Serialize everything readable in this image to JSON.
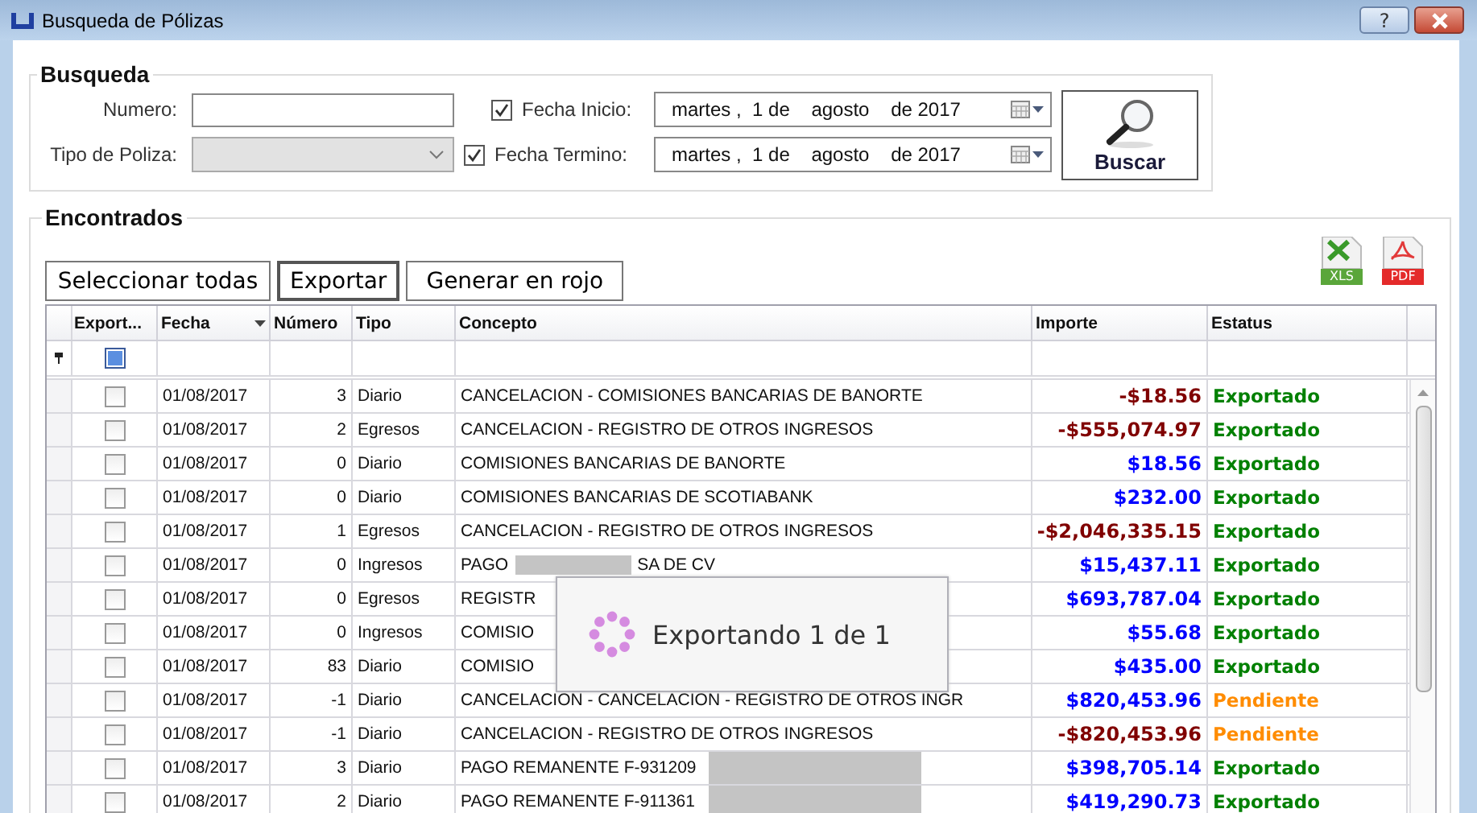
{
  "window": {
    "title": "Busqueda de Pólizas",
    "help_button": "?"
  },
  "search": {
    "legend": "Busqueda",
    "numero_label": "Numero:",
    "tipo_label": "Tipo de Poliza:",
    "tipo_disabled": true,
    "fecha_inicio": {
      "label": "Fecha Inicio:",
      "checked": true,
      "value": "martes ,  1 de    agosto    de 2017"
    },
    "fecha_termino": {
      "label": "Fecha Termino:",
      "checked": true,
      "value": "martes ,  1 de    agosto    de 2017"
    },
    "search_button": "Buscar"
  },
  "results": {
    "legend": "Encontrados",
    "buttons": [
      {
        "label": "Seleccionar todas",
        "focused": false
      },
      {
        "label": "Exportar",
        "focused": true
      },
      {
        "label": "Generar en rojo",
        "focused": false
      }
    ],
    "export_icons": [
      {
        "kind": "xls",
        "label": "XLS"
      },
      {
        "kind": "pdf",
        "label": "PDF"
      }
    ],
    "table": {
      "columns": [
        {
          "label": "Export...",
          "sorted": false
        },
        {
          "label": "Fecha",
          "sorted": true
        },
        {
          "label": "Número",
          "sorted": false
        },
        {
          "label": "Tipo",
          "sorted": false
        },
        {
          "label": "Concepto",
          "sorted": false
        },
        {
          "label": "Importe",
          "sorted": false
        },
        {
          "label": "Estatus",
          "sorted": false
        }
      ],
      "filter_row": {
        "export_indeterminate": true
      },
      "rows": [
        {
          "checked": false,
          "fecha": "01/08/2017",
          "numero": "3",
          "tipo": "Diario",
          "concepto": "CANCELACION - COMISIONES BANCARIAS DE BANORTE",
          "importe": "-$18.56",
          "negative": true,
          "estatus": "Exportado",
          "pending": false
        },
        {
          "checked": false,
          "fecha": "01/08/2017",
          "numero": "2",
          "tipo": "Egresos",
          "concepto": "CANCELACION - REGISTRO DE OTROS INGRESOS",
          "importe": "-$555,074.97",
          "negative": true,
          "estatus": "Exportado",
          "pending": false
        },
        {
          "checked": false,
          "fecha": "01/08/2017",
          "numero": "0",
          "tipo": "Diario",
          "concepto": "COMISIONES BANCARIAS DE BANORTE",
          "importe": "$18.56",
          "negative": false,
          "estatus": "Exportado",
          "pending": false
        },
        {
          "checked": false,
          "fecha": "01/08/2017",
          "numero": "0",
          "tipo": "Diario",
          "concepto": "COMISIONES BANCARIAS DE SCOTIABANK",
          "importe": "$232.00",
          "negative": false,
          "estatus": "Exportado",
          "pending": false
        },
        {
          "checked": false,
          "fecha": "01/08/2017",
          "numero": "1",
          "tipo": "Egresos",
          "concepto": "CANCELACION - REGISTRO DE OTROS INGRESOS",
          "importe": "-$2,046,335.15",
          "negative": true,
          "estatus": "Exportado",
          "pending": false
        },
        {
          "checked": false,
          "fecha": "01/08/2017",
          "numero": "0",
          "tipo": "Ingresos",
          "concepto": "PAGO",
          "redacted": true,
          "concepto_tail": "SA DE CV",
          "importe": "$15,437.11",
          "negative": false,
          "estatus": "Exportado",
          "pending": false
        },
        {
          "checked": false,
          "fecha": "01/08/2017",
          "numero": "0",
          "tipo": "Egresos",
          "concepto": "REGISTR",
          "importe": "$693,787.04",
          "negative": false,
          "estatus": "Exportado",
          "pending": false
        },
        {
          "checked": false,
          "fecha": "01/08/2017",
          "numero": "0",
          "tipo": "Ingresos",
          "concepto": "COMISIO",
          "importe": "$55.68",
          "negative": false,
          "estatus": "Exportado",
          "pending": false
        },
        {
          "checked": false,
          "fecha": "01/08/2017",
          "numero": "83",
          "tipo": "Diario",
          "concepto": "COMISIO",
          "importe": "$435.00",
          "negative": false,
          "estatus": "Exportado",
          "pending": false
        },
        {
          "checked": false,
          "fecha": "01/08/2017",
          "numero": "-1",
          "tipo": "Diario",
          "concepto": "CANCELACION - CANCELACION - REGISTRO DE OTROS INGR",
          "importe": "$820,453.96",
          "negative": false,
          "estatus": "Pendiente",
          "pending": true
        },
        {
          "checked": false,
          "fecha": "01/08/2017",
          "numero": "-1",
          "tipo": "Diario",
          "concepto": "CANCELACION - REGISTRO DE OTROS INGRESOS",
          "importe": "-$820,453.96",
          "negative": true,
          "estatus": "Pendiente",
          "pending": true
        },
        {
          "checked": false,
          "fecha": "01/08/2017",
          "numero": "3",
          "tipo": "Diario",
          "concepto": "PAGO REMANENTE F-931209",
          "redacted": true,
          "importe": "$398,705.14",
          "negative": false,
          "estatus": "Exportado",
          "pending": false
        },
        {
          "checked": false,
          "fecha": "01/08/2017",
          "numero": "2",
          "tipo": "Diario",
          "concepto": "PAGO REMANENTE F-911361",
          "redacted": true,
          "importe": "$419,290.73",
          "negative": false,
          "estatus": "Exportado",
          "pending": false
        }
      ]
    },
    "progress": {
      "message": "Exportando 1 de 1"
    }
  }
}
